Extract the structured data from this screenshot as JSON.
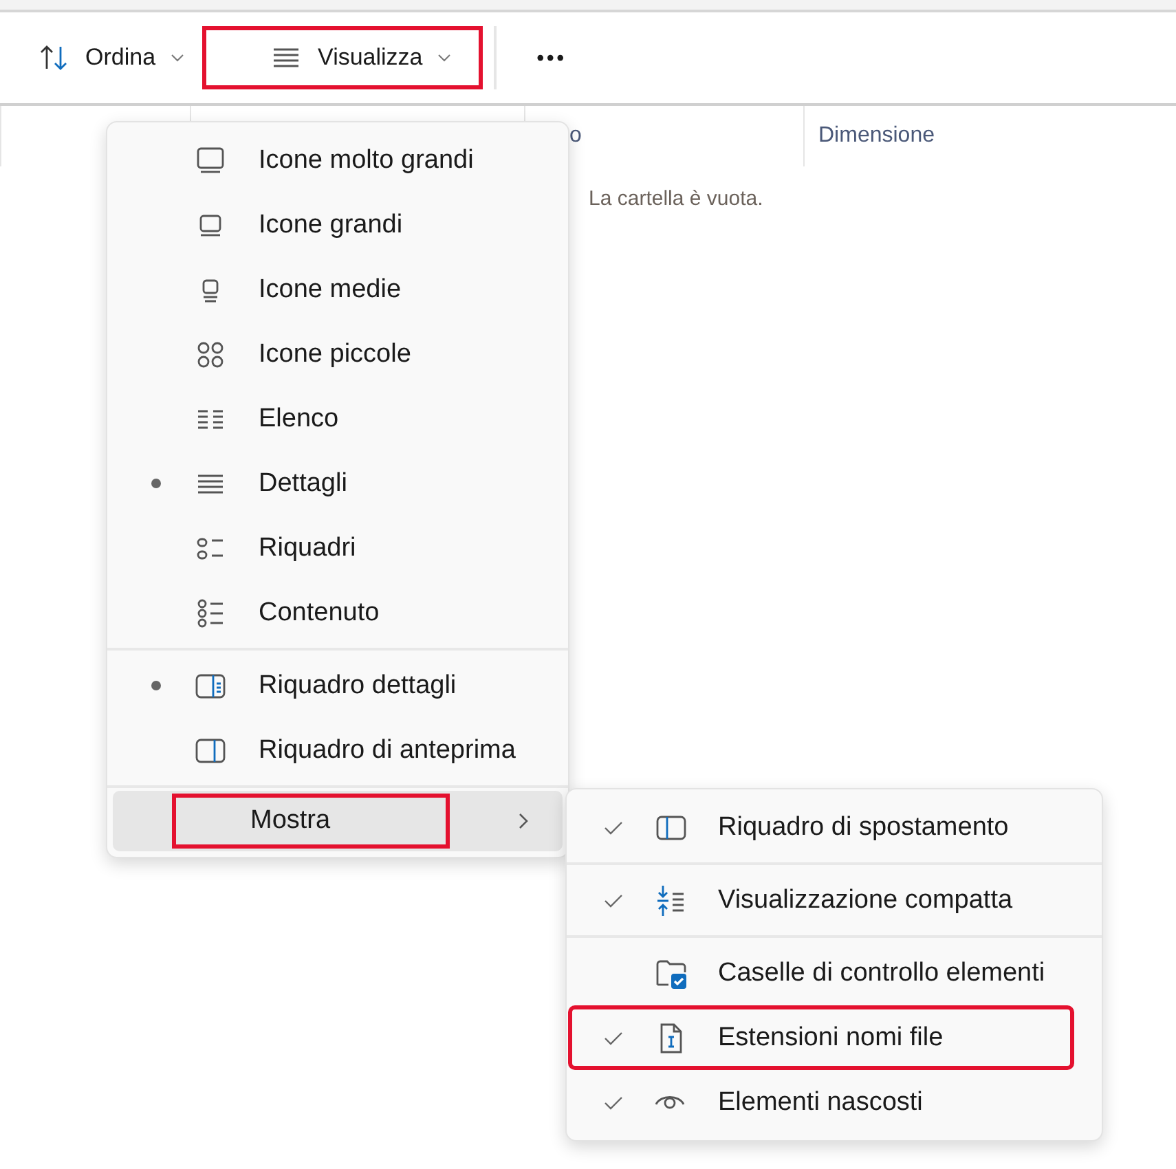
{
  "toolbar": {
    "buttons": [
      {
        "kind": "sort",
        "label": "Ordina",
        "highlighted": false
      },
      {
        "kind": "view",
        "label": "Visualizza",
        "highlighted": true
      },
      {
        "kind": "more",
        "label": "•••",
        "highlighted": false
      }
    ]
  },
  "table": {
    "columns": [
      {
        "label": "o"
      },
      {
        "label": "Dimensione"
      }
    ],
    "empty_message": "La cartella è vuota."
  },
  "view_menu": {
    "sections": [
      {
        "items": [
          {
            "kind": "xl",
            "label": "Icone molto grandi",
            "selected": false
          },
          {
            "kind": "large",
            "label": "Icone grandi",
            "selected": false
          },
          {
            "kind": "medium",
            "label": "Icone medie",
            "selected": false
          },
          {
            "kind": "small",
            "label": "Icone piccole",
            "selected": false
          },
          {
            "kind": "list",
            "label": "Elenco",
            "selected": false
          },
          {
            "kind": "details",
            "label": "Dettagli",
            "selected": true
          },
          {
            "kind": "tiles",
            "label": "Riquadri",
            "selected": false
          },
          {
            "kind": "content",
            "label": "Contenuto",
            "selected": false
          }
        ]
      },
      {
        "items": [
          {
            "kind": "detailspane",
            "label": "Riquadro dettagli",
            "selected": true
          },
          {
            "kind": "previewpane",
            "label": "Riquadro di anteprima",
            "selected": false
          }
        ]
      },
      {
        "items": [
          {
            "kind": "submenu",
            "label": "Mostra",
            "expanded": true,
            "highlighted": true
          }
        ]
      }
    ]
  },
  "show_menu": {
    "sections": [
      {
        "items": [
          {
            "kind": "navigation",
            "label": "Riquadro di spostamento",
            "checked": true,
            "highlighted": false
          }
        ]
      },
      {
        "items": [
          {
            "kind": "compact",
            "label": "Visualizzazione compatta",
            "checked": true,
            "highlighted": false
          }
        ]
      },
      {
        "items": [
          {
            "kind": "checkboxes",
            "label": "Caselle di controllo elementi",
            "checked": false,
            "highlighted": false
          },
          {
            "kind": "extensions",
            "label": "Estensioni nomi file",
            "checked": true,
            "highlighted": true
          },
          {
            "kind": "hidden",
            "label": "Elementi nascosti",
            "checked": true,
            "highlighted": false
          }
        ]
      }
    ]
  }
}
